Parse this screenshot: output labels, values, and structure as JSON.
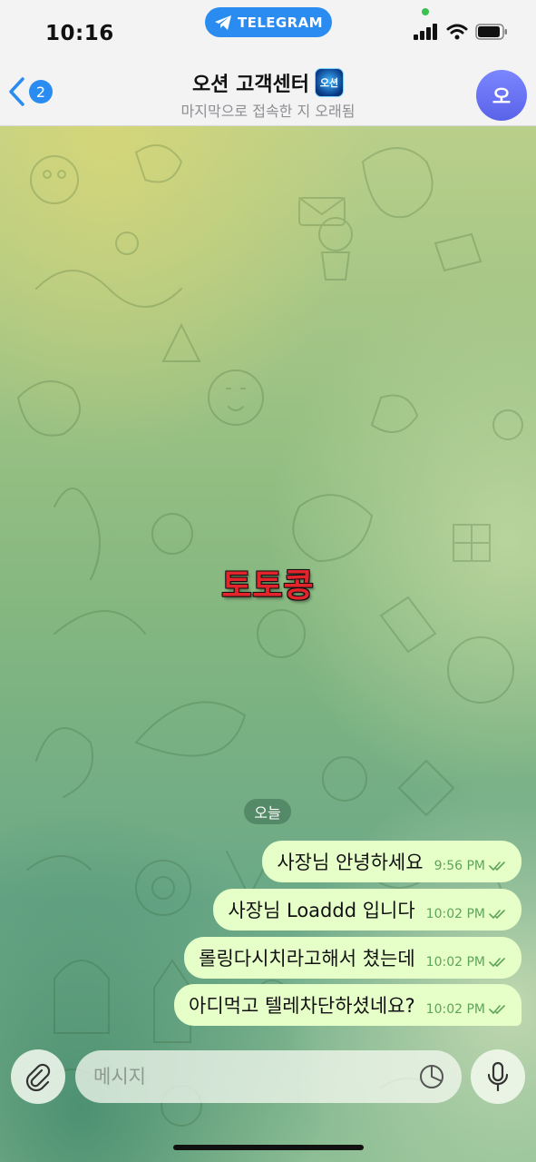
{
  "status_bar": {
    "time": "10:16",
    "app_pill": "TELEGRAM"
  },
  "header": {
    "back_count": "2",
    "title": "오션 고객센터",
    "title_badge_text": "오션",
    "subtitle": "마지막으로 접속한 지 오래됨",
    "avatar_initial": "오"
  },
  "watermark": "토토콩",
  "date_separator": "오늘",
  "messages": [
    {
      "text": "사장님 안녕하세요",
      "time": "9:56 PM",
      "status": "read"
    },
    {
      "text": "사장님 Loaddd 입니다",
      "time": "10:02 PM",
      "status": "read"
    },
    {
      "text": "롤링다시치라고해서 쳤는데",
      "time": "10:02 PM",
      "status": "read"
    },
    {
      "text": "아디먹고 텔레차단하셨네요?",
      "time": "10:02 PM",
      "status": "read"
    }
  ],
  "input": {
    "placeholder": "메시지",
    "value": ""
  },
  "colors": {
    "accent": "#2a8cf0",
    "bubble_out": "#e6ffc8",
    "time_text": "#5fa45b",
    "watermark": "#e3242b"
  },
  "icons": [
    "telegram-icon",
    "signal-icon",
    "wifi-icon",
    "battery-icon",
    "back-chevron-icon",
    "attach-icon",
    "sticker-icon",
    "mic-icon",
    "double-check-icon"
  ]
}
